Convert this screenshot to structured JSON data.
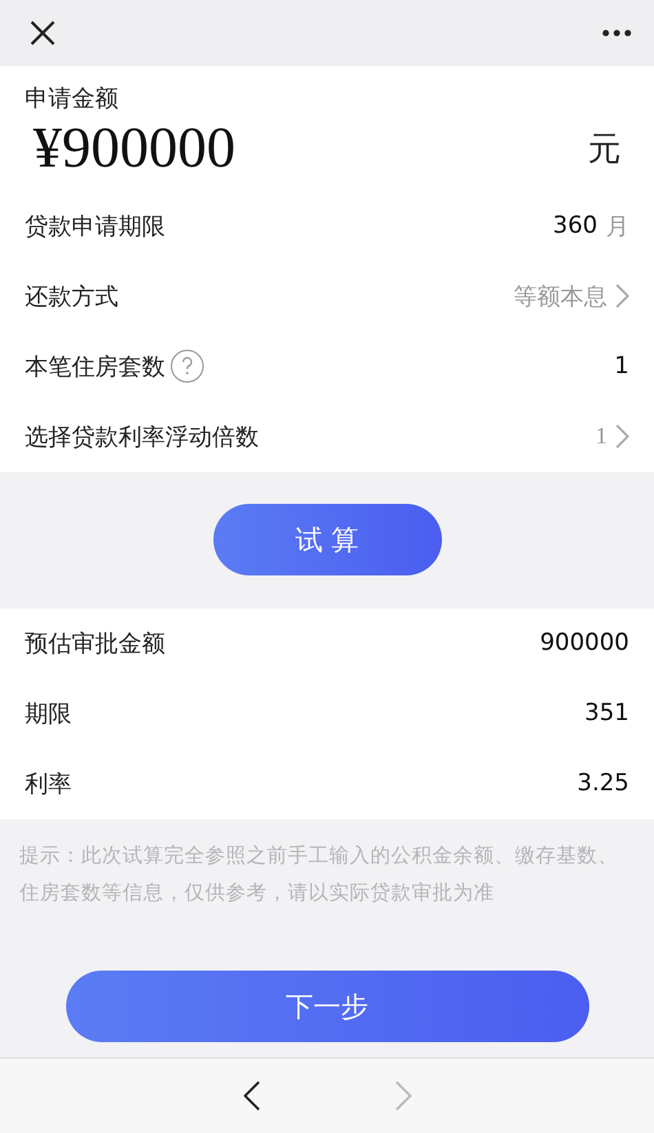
{
  "amount": {
    "label": "申请金额",
    "value": "¥900000",
    "unit": "元"
  },
  "form_rows": [
    {
      "label": "贷款申请期限",
      "value": "360",
      "unit": "月",
      "help": false,
      "chevron": false,
      "muted": false
    },
    {
      "label": "还款方式",
      "value": "等额本息",
      "help": false,
      "chevron": true,
      "muted": true
    },
    {
      "label": "本笔住房套数",
      "value": "1",
      "help": true,
      "chevron": false,
      "muted": false
    },
    {
      "label": "选择贷款利率浮动倍数",
      "value": "1",
      "help": false,
      "chevron": true,
      "muted": true
    }
  ],
  "calc_button": "试 算",
  "results": [
    {
      "label": "预估审批金额",
      "value": "900000"
    },
    {
      "label": "期限",
      "value": "351"
    },
    {
      "label": "利率",
      "value": "3.25"
    }
  ],
  "hint": "提示：此次试算完全参照之前手工输入的公积金余额、缴存基数、住房套数等信息，仅供参考，请以实际贷款审批为准",
  "next_button": "下一步",
  "nav": [
    {
      "disabled": false
    },
    {
      "disabled": true
    }
  ]
}
